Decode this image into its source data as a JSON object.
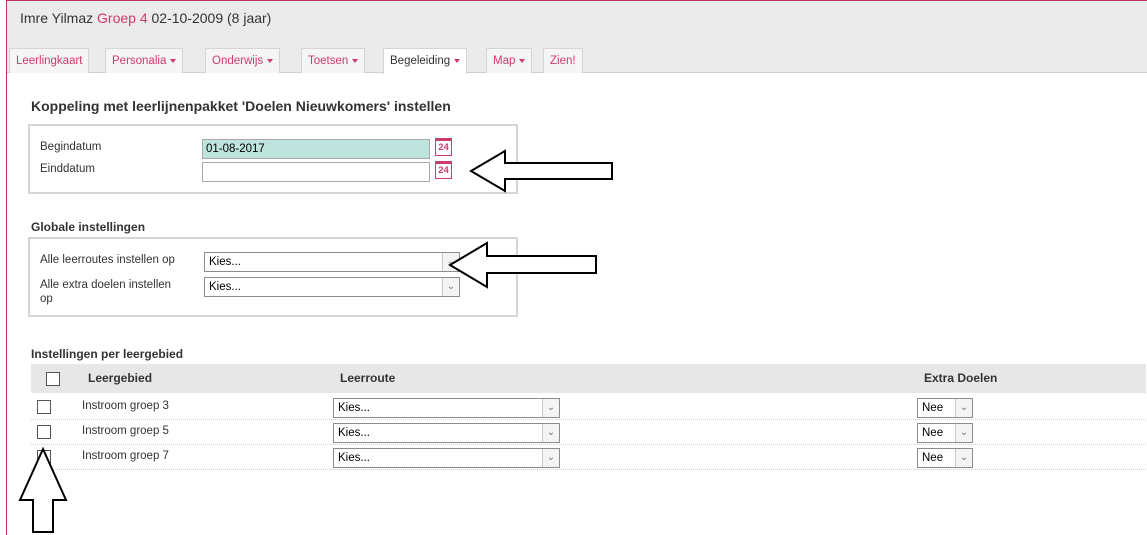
{
  "header": {
    "student_name": "Imre Yilmaz",
    "group": "Groep 4",
    "birth": "02-10-2009 (8 jaar)"
  },
  "tabs": [
    {
      "label": "Leerlingkaart",
      "dropdown": false,
      "active": false
    },
    {
      "label": "Personalia",
      "dropdown": true,
      "active": false
    },
    {
      "label": "Onderwijs",
      "dropdown": true,
      "active": false
    },
    {
      "label": "Toetsen",
      "dropdown": true,
      "active": false
    },
    {
      "label": "Begeleiding",
      "dropdown": true,
      "active": true
    },
    {
      "label": "Map",
      "dropdown": true,
      "active": false
    },
    {
      "label": "Zien!",
      "dropdown": false,
      "active": false
    }
  ],
  "page_title": "Koppeling met leerlijnenpakket 'Doelen Nieuwkomers' instellen",
  "dates": {
    "begin_label": "Begindatum",
    "begin_value": "01-08-2017",
    "end_label": "Einddatum",
    "end_value": "",
    "calendar_icon_text": "24"
  },
  "global": {
    "heading": "Globale instellingen",
    "routes_label": "Alle leerroutes instellen op",
    "routes_value": "Kies...",
    "extra_label_line1": "Alle extra doelen instellen",
    "extra_label_line2": "op",
    "extra_value": "Kies..."
  },
  "per_area": {
    "heading": "Instellingen per leergebied",
    "columns": {
      "area": "Leergebied",
      "route": "Leerroute",
      "extra": "Extra Doelen"
    },
    "rows": [
      {
        "area": "Instroom groep 3",
        "route": "Kies...",
        "extra": "Nee"
      },
      {
        "area": "Instroom groep 5",
        "route": "Kies...",
        "extra": "Nee"
      },
      {
        "area": "Instroom groep 7",
        "route": "Kies...",
        "extra": "Nee"
      }
    ]
  },
  "colors": {
    "accent": "#d1386c",
    "filled_input": "#bfe4dd",
    "header_bg": "#ebebeb"
  }
}
